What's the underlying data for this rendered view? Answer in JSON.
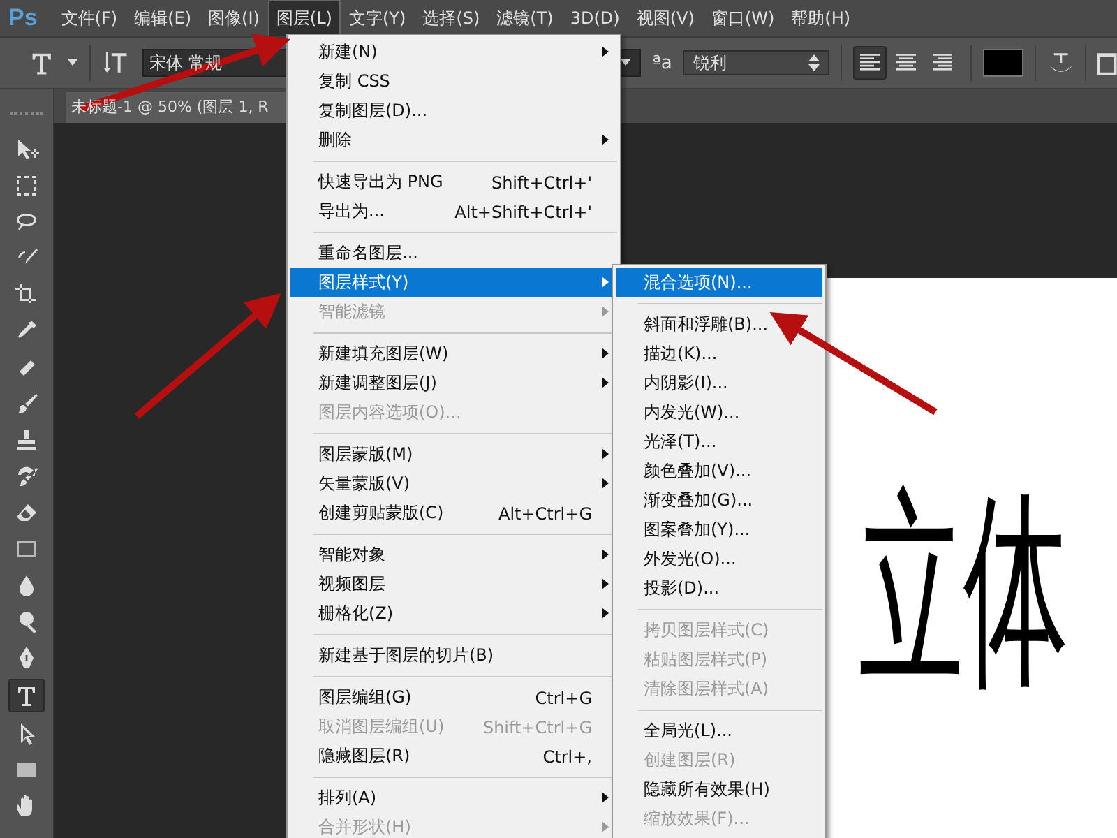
{
  "app_logo": "Ps",
  "menubar": [
    {
      "label": "文件(F)",
      "selected": false
    },
    {
      "label": "编辑(E)",
      "selected": false
    },
    {
      "label": "图像(I)",
      "selected": false
    },
    {
      "label": "图层(L)",
      "selected": true
    },
    {
      "label": "文字(Y)",
      "selected": false
    },
    {
      "label": "选择(S)",
      "selected": false
    },
    {
      "label": "滤镜(T)",
      "selected": false
    },
    {
      "label": "3D(D)",
      "selected": false
    },
    {
      "label": "视图(V)",
      "selected": false
    },
    {
      "label": "窗口(W)",
      "selected": false
    },
    {
      "label": "帮助(H)",
      "selected": false
    }
  ],
  "options_bar": {
    "font_family": "宋体 常规",
    "antialias_icon": "ªa",
    "antialias": "锐利",
    "alignment": [
      {
        "selected": true
      },
      {
        "selected": false
      },
      {
        "selected": false
      }
    ]
  },
  "document_tab": {
    "title": "未标题-1 @ 50% (图层 1, R"
  },
  "tools": [
    {
      "kind": "move",
      "selected": false
    },
    {
      "kind": "marquee",
      "selected": false
    },
    {
      "kind": "lasso",
      "selected": false
    },
    {
      "kind": "quick",
      "selected": false
    },
    {
      "kind": "crop",
      "selected": false
    },
    {
      "kind": "eyedropper",
      "selected": false
    },
    {
      "kind": "heal",
      "selected": false
    },
    {
      "kind": "brush",
      "selected": false
    },
    {
      "kind": "stamp",
      "selected": false
    },
    {
      "kind": "history",
      "selected": false
    },
    {
      "kind": "eraser",
      "selected": false
    },
    {
      "kind": "gradient",
      "selected": false
    },
    {
      "kind": "blur",
      "selected": false
    },
    {
      "kind": "dodge",
      "selected": false
    },
    {
      "kind": "pen",
      "selected": false
    },
    {
      "kind": "type",
      "selected": true
    },
    {
      "kind": "pathselect",
      "selected": false
    },
    {
      "kind": "rect",
      "selected": false
    },
    {
      "kind": "hand",
      "selected": false
    }
  ],
  "canvas_text": "立体",
  "layer_menu": {
    "groups": [
      {
        "items": [
          {
            "label": "新建(N)",
            "submenu": true,
            "selected": false,
            "disabled": false
          },
          {
            "label": "复制 CSS",
            "selected": false,
            "disabled": false
          },
          {
            "label": "复制图层(D)...",
            "selected": false,
            "disabled": false
          },
          {
            "label": "删除",
            "submenu": true,
            "selected": false,
            "disabled": false
          }
        ]
      },
      {
        "items": [
          {
            "label": "快速导出为 PNG",
            "shortcut": "Shift+Ctrl+'",
            "selected": false,
            "disabled": false
          },
          {
            "label": "导出为...",
            "shortcut": "Alt+Shift+Ctrl+'",
            "selected": false,
            "disabled": false
          }
        ]
      },
      {
        "items": [
          {
            "label": "重命名图层...",
            "selected": false,
            "disabled": false
          },
          {
            "label": "图层样式(Y)",
            "submenu": true,
            "selected": true,
            "disabled": false
          },
          {
            "label": "智能滤镜",
            "submenu": true,
            "selected": false,
            "disabled": true
          }
        ]
      },
      {
        "items": [
          {
            "label": "新建填充图层(W)",
            "submenu": true,
            "selected": false,
            "disabled": false
          },
          {
            "label": "新建调整图层(J)",
            "submenu": true,
            "selected": false,
            "disabled": false
          },
          {
            "label": "图层内容选项(O)...",
            "selected": false,
            "disabled": true
          }
        ]
      },
      {
        "items": [
          {
            "label": "图层蒙版(M)",
            "submenu": true,
            "selected": false,
            "disabled": false
          },
          {
            "label": "矢量蒙版(V)",
            "submenu": true,
            "selected": false,
            "disabled": false
          },
          {
            "label": "创建剪贴蒙版(C)",
            "shortcut": "Alt+Ctrl+G",
            "selected": false,
            "disabled": false
          }
        ]
      },
      {
        "items": [
          {
            "label": "智能对象",
            "submenu": true,
            "selected": false,
            "disabled": false
          },
          {
            "label": "视频图层",
            "submenu": true,
            "selected": false,
            "disabled": false
          },
          {
            "label": "栅格化(Z)",
            "submenu": true,
            "selected": false,
            "disabled": false
          }
        ]
      },
      {
        "items": [
          {
            "label": "新建基于图层的切片(B)",
            "selected": false,
            "disabled": false
          }
        ]
      },
      {
        "items": [
          {
            "label": "图层编组(G)",
            "shortcut": "Ctrl+G",
            "selected": false,
            "disabled": false
          },
          {
            "label": "取消图层编组(U)",
            "shortcut": "Shift+Ctrl+G",
            "selected": false,
            "disabled": true
          },
          {
            "label": "隐藏图层(R)",
            "shortcut": "Ctrl+,",
            "selected": false,
            "disabled": false
          }
        ]
      },
      {
        "items": [
          {
            "label": "排列(A)",
            "submenu": true,
            "selected": false,
            "disabled": false
          },
          {
            "label": "合并形状(H)",
            "submenu": true,
            "selected": false,
            "disabled": true
          }
        ]
      }
    ]
  },
  "style_submenu": {
    "groups": [
      {
        "items": [
          {
            "label": "混合选项(N)...",
            "selected": true,
            "disabled": false
          }
        ]
      },
      {
        "items": [
          {
            "label": "斜面和浮雕(B)...",
            "selected": false,
            "disabled": false
          },
          {
            "label": "描边(K)...",
            "selected": false,
            "disabled": false
          },
          {
            "label": "内阴影(I)...",
            "selected": false,
            "disabled": false
          },
          {
            "label": "内发光(W)...",
            "selected": false,
            "disabled": false
          },
          {
            "label": "光泽(T)...",
            "selected": false,
            "disabled": false
          },
          {
            "label": "颜色叠加(V)...",
            "selected": false,
            "disabled": false
          },
          {
            "label": "渐变叠加(G)...",
            "selected": false,
            "disabled": false
          },
          {
            "label": "图案叠加(Y)...",
            "selected": false,
            "disabled": false
          },
          {
            "label": "外发光(O)...",
            "selected": false,
            "disabled": false
          },
          {
            "label": "投影(D)...",
            "selected": false,
            "disabled": false
          }
        ]
      },
      {
        "items": [
          {
            "label": "拷贝图层样式(C)",
            "selected": false,
            "disabled": true
          },
          {
            "label": "粘贴图层样式(P)",
            "selected": false,
            "disabled": true
          },
          {
            "label": "清除图层样式(A)",
            "selected": false,
            "disabled": true
          }
        ]
      },
      {
        "items": [
          {
            "label": "全局光(L)...",
            "selected": false,
            "disabled": false
          },
          {
            "label": "创建图层(R)",
            "selected": false,
            "disabled": true
          },
          {
            "label": "隐藏所有效果(H)",
            "selected": false,
            "disabled": false
          },
          {
            "label": "缩放效果(F)...",
            "selected": false,
            "disabled": true
          }
        ]
      }
    ]
  }
}
